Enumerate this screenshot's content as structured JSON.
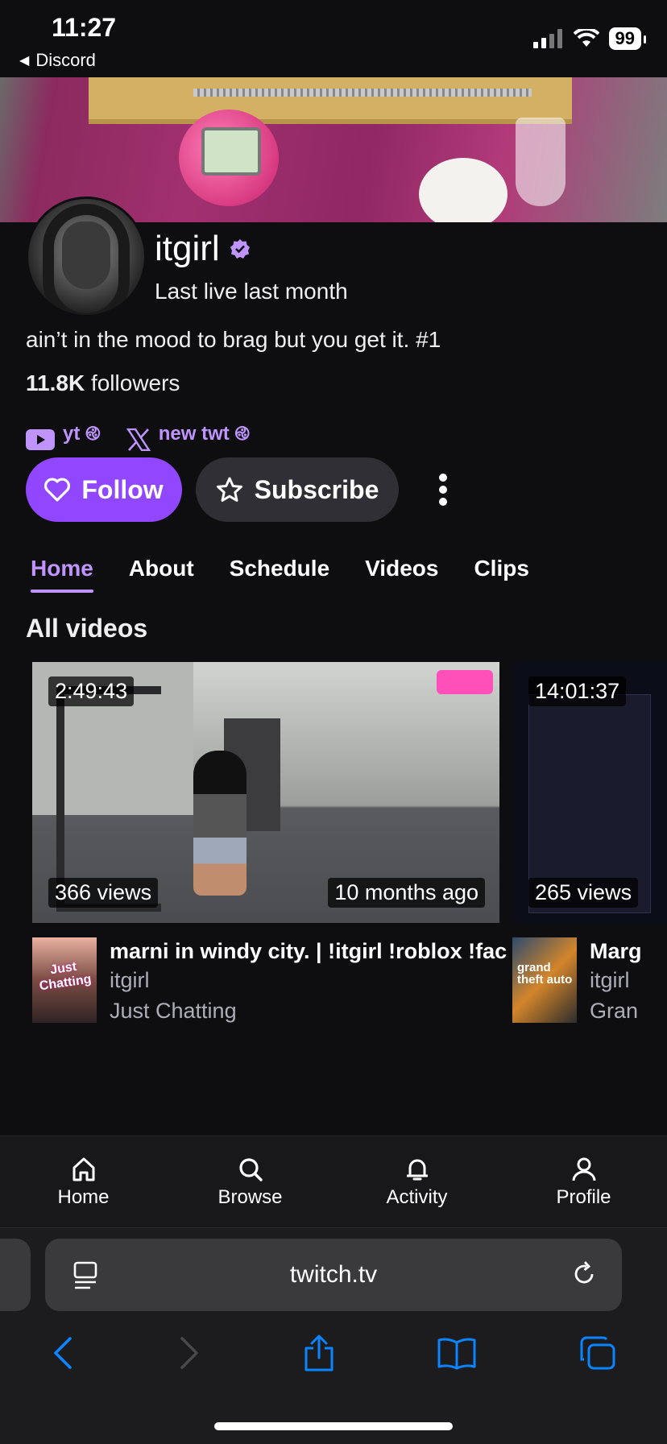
{
  "status_bar": {
    "time": "11:27",
    "back_app": "Discord",
    "battery": "99"
  },
  "channel": {
    "name": "itgirl",
    "last_live": "Last live last month",
    "bio": "ain’t in the mood to brag but you get it. #1",
    "followers_count": "11.8K",
    "followers_label": "followers",
    "links": [
      {
        "icon": "youtube-icon",
        "label": "yt ࿋"
      },
      {
        "icon": "x-icon",
        "label": "new twt ࿋"
      }
    ]
  },
  "actions": {
    "follow": "Follow",
    "subscribe": "Subscribe"
  },
  "tabs": [
    {
      "label": "Home",
      "active": true
    },
    {
      "label": "About"
    },
    {
      "label": "Schedule"
    },
    {
      "label": "Videos"
    },
    {
      "label": "Clips"
    }
  ],
  "section_title": "All videos",
  "videos": [
    {
      "duration": "2:49:43",
      "views": "366 views",
      "age": "10 months ago",
      "title": "marni in windy city. | !itgirl !roblox !fac",
      "channel": "itgirl",
      "category": "Just Chatting",
      "category_art": "Just Chatting"
    },
    {
      "duration": "14:01:37",
      "views": "265 views",
      "age": "",
      "title": "Marg",
      "channel": "itgirl",
      "category": "Gran",
      "category_art": "grand theft auto"
    }
  ],
  "bottom_nav": [
    {
      "label": "Home",
      "icon": "home-icon"
    },
    {
      "label": "Browse",
      "icon": "search-icon"
    },
    {
      "label": "Activity",
      "icon": "bell-icon"
    },
    {
      "label": "Profile",
      "icon": "profile-icon"
    }
  ],
  "browser": {
    "url": "twitch.tv"
  },
  "colors": {
    "accent": "#9147ff",
    "accent_text": "#bf94ff",
    "background": "#0e0e10",
    "safari_blue": "#0a84ff"
  }
}
